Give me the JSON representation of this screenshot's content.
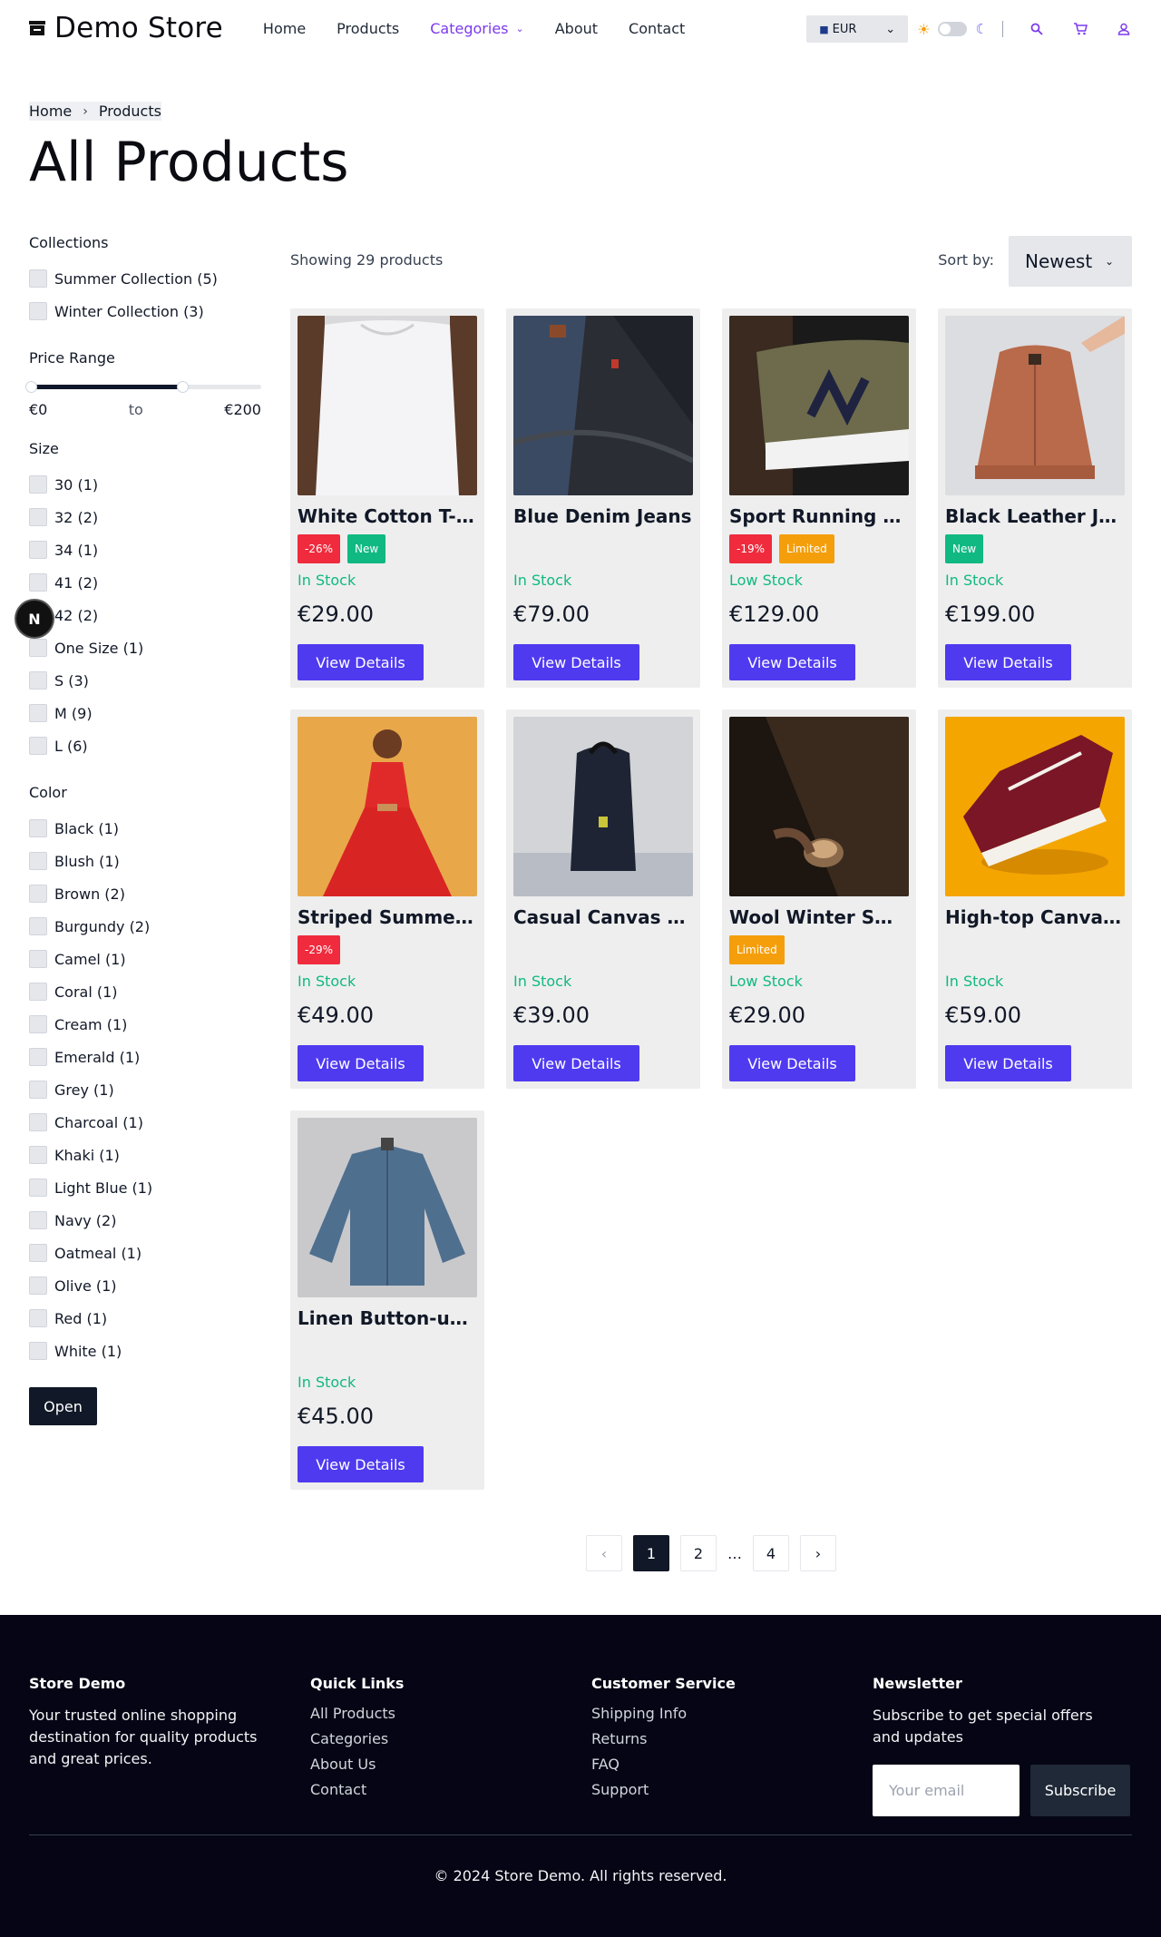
{
  "header": {
    "logo_text": "Demo Store",
    "logo_icon": "store-icon",
    "nav": [
      {
        "label": "Home"
      },
      {
        "label": "Products"
      },
      {
        "label": "Categories"
      },
      {
        "label": "About"
      },
      {
        "label": "Contact"
      }
    ],
    "currency": "EUR",
    "accent_color": "#7c3aed"
  },
  "breadcrumb": [
    "Home",
    "Products"
  ],
  "page_title": "All Products",
  "filters": {
    "collections": {
      "title": "Collections",
      "items": [
        "Summer Collection (5)",
        "Winter Collection (3)"
      ]
    },
    "price": {
      "title": "Price Range",
      "min_label": "€0",
      "to_label": "to",
      "max_label": "€200",
      "selected_fraction": 0.66
    },
    "size": {
      "title": "Size",
      "items": [
        "30 (1)",
        "32 (2)",
        "34 (1)",
        "41 (2)",
        "42 (2)",
        "One Size (1)",
        "S (3)",
        "M (9)",
        "L (6)"
      ]
    },
    "color": {
      "title": "Color",
      "items": [
        "Black (1)",
        "Blush (1)",
        "Brown (2)",
        "Burgundy (2)",
        "Camel (1)",
        "Coral (1)",
        "Cream (1)",
        "Emerald (1)",
        "Grey (1)",
        "Charcoal (1)",
        "Khaki (1)",
        "Light Blue (1)",
        "Navy (2)",
        "Oatmeal (1)",
        "Olive (1)",
        "Red (1)",
        "White (1)"
      ]
    },
    "open_label": "Open"
  },
  "floating_badge": "N",
  "results": {
    "showing": "Showing 29 products",
    "sort_label": "Sort by:",
    "sort_value": "Newest"
  },
  "products": [
    {
      "name": "White Cotton T-Shirt",
      "badges": [
        {
          "text": "-26%",
          "kind": "sale"
        },
        {
          "text": "New",
          "kind": "new"
        }
      ],
      "stock": "In Stock",
      "price": "€29.00",
      "button": "View Details"
    },
    {
      "name": "Blue Denim Jeans",
      "badges": [],
      "stock": "In Stock",
      "price": "€79.00",
      "button": "View Details"
    },
    {
      "name": "Sport Running Shoes",
      "badges": [
        {
          "text": "-19%",
          "kind": "sale"
        },
        {
          "text": "Limited",
          "kind": "limited"
        }
      ],
      "stock": "Low Stock",
      "price": "€129.00",
      "button": "View Details"
    },
    {
      "name": "Black Leather Jacket",
      "badges": [
        {
          "text": "New",
          "kind": "new"
        }
      ],
      "stock": "In Stock",
      "price": "€199.00",
      "button": "View Details"
    },
    {
      "name": "Striped Summer Dress",
      "badges": [
        {
          "text": "-29%",
          "kind": "sale"
        }
      ],
      "stock": "In Stock",
      "price": "€49.00",
      "button": "View Details"
    },
    {
      "name": "Casual Canvas Backpack",
      "badges": [],
      "stock": "In Stock",
      "price": "€39.00",
      "button": "View Details"
    },
    {
      "name": "Wool Winter Sweater",
      "badges": [
        {
          "text": "Limited",
          "kind": "limited"
        }
      ],
      "stock": "Low Stock",
      "price": "€29.00",
      "button": "View Details"
    },
    {
      "name": "High-top Canvas Sneakers",
      "badges": [],
      "stock": "In Stock",
      "price": "€59.00",
      "button": "View Details"
    },
    {
      "name": "Linen Button-up Shirt",
      "badges": [],
      "stock": "In Stock",
      "price": "€45.00",
      "button": "View Details"
    }
  ],
  "pagination": {
    "prev": "‹",
    "pages": [
      "1",
      "2",
      "…",
      "4"
    ],
    "current": "1",
    "next": "›"
  },
  "footer": {
    "about_title": "Store Demo",
    "about_text": "Your trusted online shopping destination for quality products and great prices.",
    "links_title": "Quick Links",
    "links": [
      "All Products",
      "Categories",
      "About Us",
      "Contact"
    ],
    "service_title": "Customer Service",
    "service_links": [
      "Shipping Info",
      "Returns",
      "FAQ",
      "Support"
    ],
    "newsletter_title": "Newsletter",
    "newsletter_text": "Subscribe to get special offers and updates",
    "email_placeholder": "Your email",
    "subscribe_label": "Subscribe",
    "copyright": "© 2024 Store Demo. All rights reserved."
  }
}
